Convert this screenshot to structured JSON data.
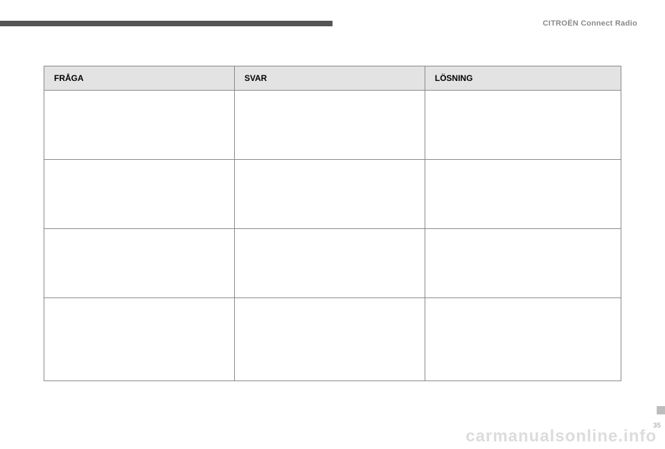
{
  "header": {
    "brand_section": "CITROËN Connect Radio"
  },
  "table": {
    "headers": {
      "col1": "FRÅGA",
      "col2": "SVAR",
      "col3": "LÖSNING"
    },
    "rows": [
      {
        "c1": "",
        "c2": "",
        "c3": ""
      },
      {
        "c1": "",
        "c2": "",
        "c3": ""
      },
      {
        "c1": "",
        "c2": "",
        "c3": ""
      },
      {
        "c1": "",
        "c2": "",
        "c3": ""
      }
    ]
  },
  "footer": {
    "watermark": "carmanualsonline.info",
    "page_number": "35"
  }
}
